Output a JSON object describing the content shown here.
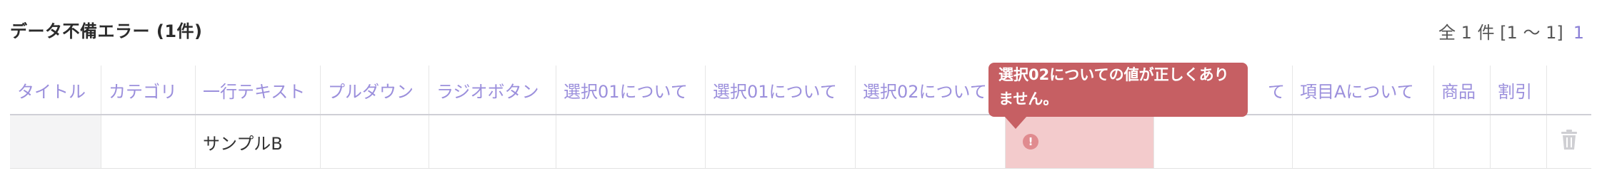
{
  "page": {
    "title": "データ不備エラー (1件)",
    "pager_summary": "全 1 件 [1 〜 1]",
    "pager_current_page": "1"
  },
  "table": {
    "columns": [
      {
        "label": "タイトル"
      },
      {
        "label": "カテゴリ"
      },
      {
        "label": "一行テキスト"
      },
      {
        "label": "プルダウン"
      },
      {
        "label": "ラジオボタン"
      },
      {
        "label": "選択01について"
      },
      {
        "label": "選択01について"
      },
      {
        "label": "選択02について"
      },
      {
        "label": ""
      },
      {
        "label": "て"
      },
      {
        "label": "項目Aについて"
      },
      {
        "label": "商品"
      },
      {
        "label": "割引"
      },
      {
        "label": ""
      }
    ],
    "rows": [
      {
        "cells": [
          "",
          "",
          "サンプルB",
          "",
          "",
          "",
          "",
          "",
          "",
          "",
          "",
          "",
          ""
        ],
        "error_column_index": 8,
        "error_icon": "exclamation-circle-icon",
        "delete_icon": "trash-icon"
      }
    ]
  },
  "tooltip": {
    "message": "選択02についての値が正しくありません。"
  },
  "colors": {
    "header_text": "#9b8fdc",
    "error_cell_bg": "#f3cbcc",
    "tooltip_bg": "#c65f63",
    "error_icon": "#e08b8f"
  }
}
